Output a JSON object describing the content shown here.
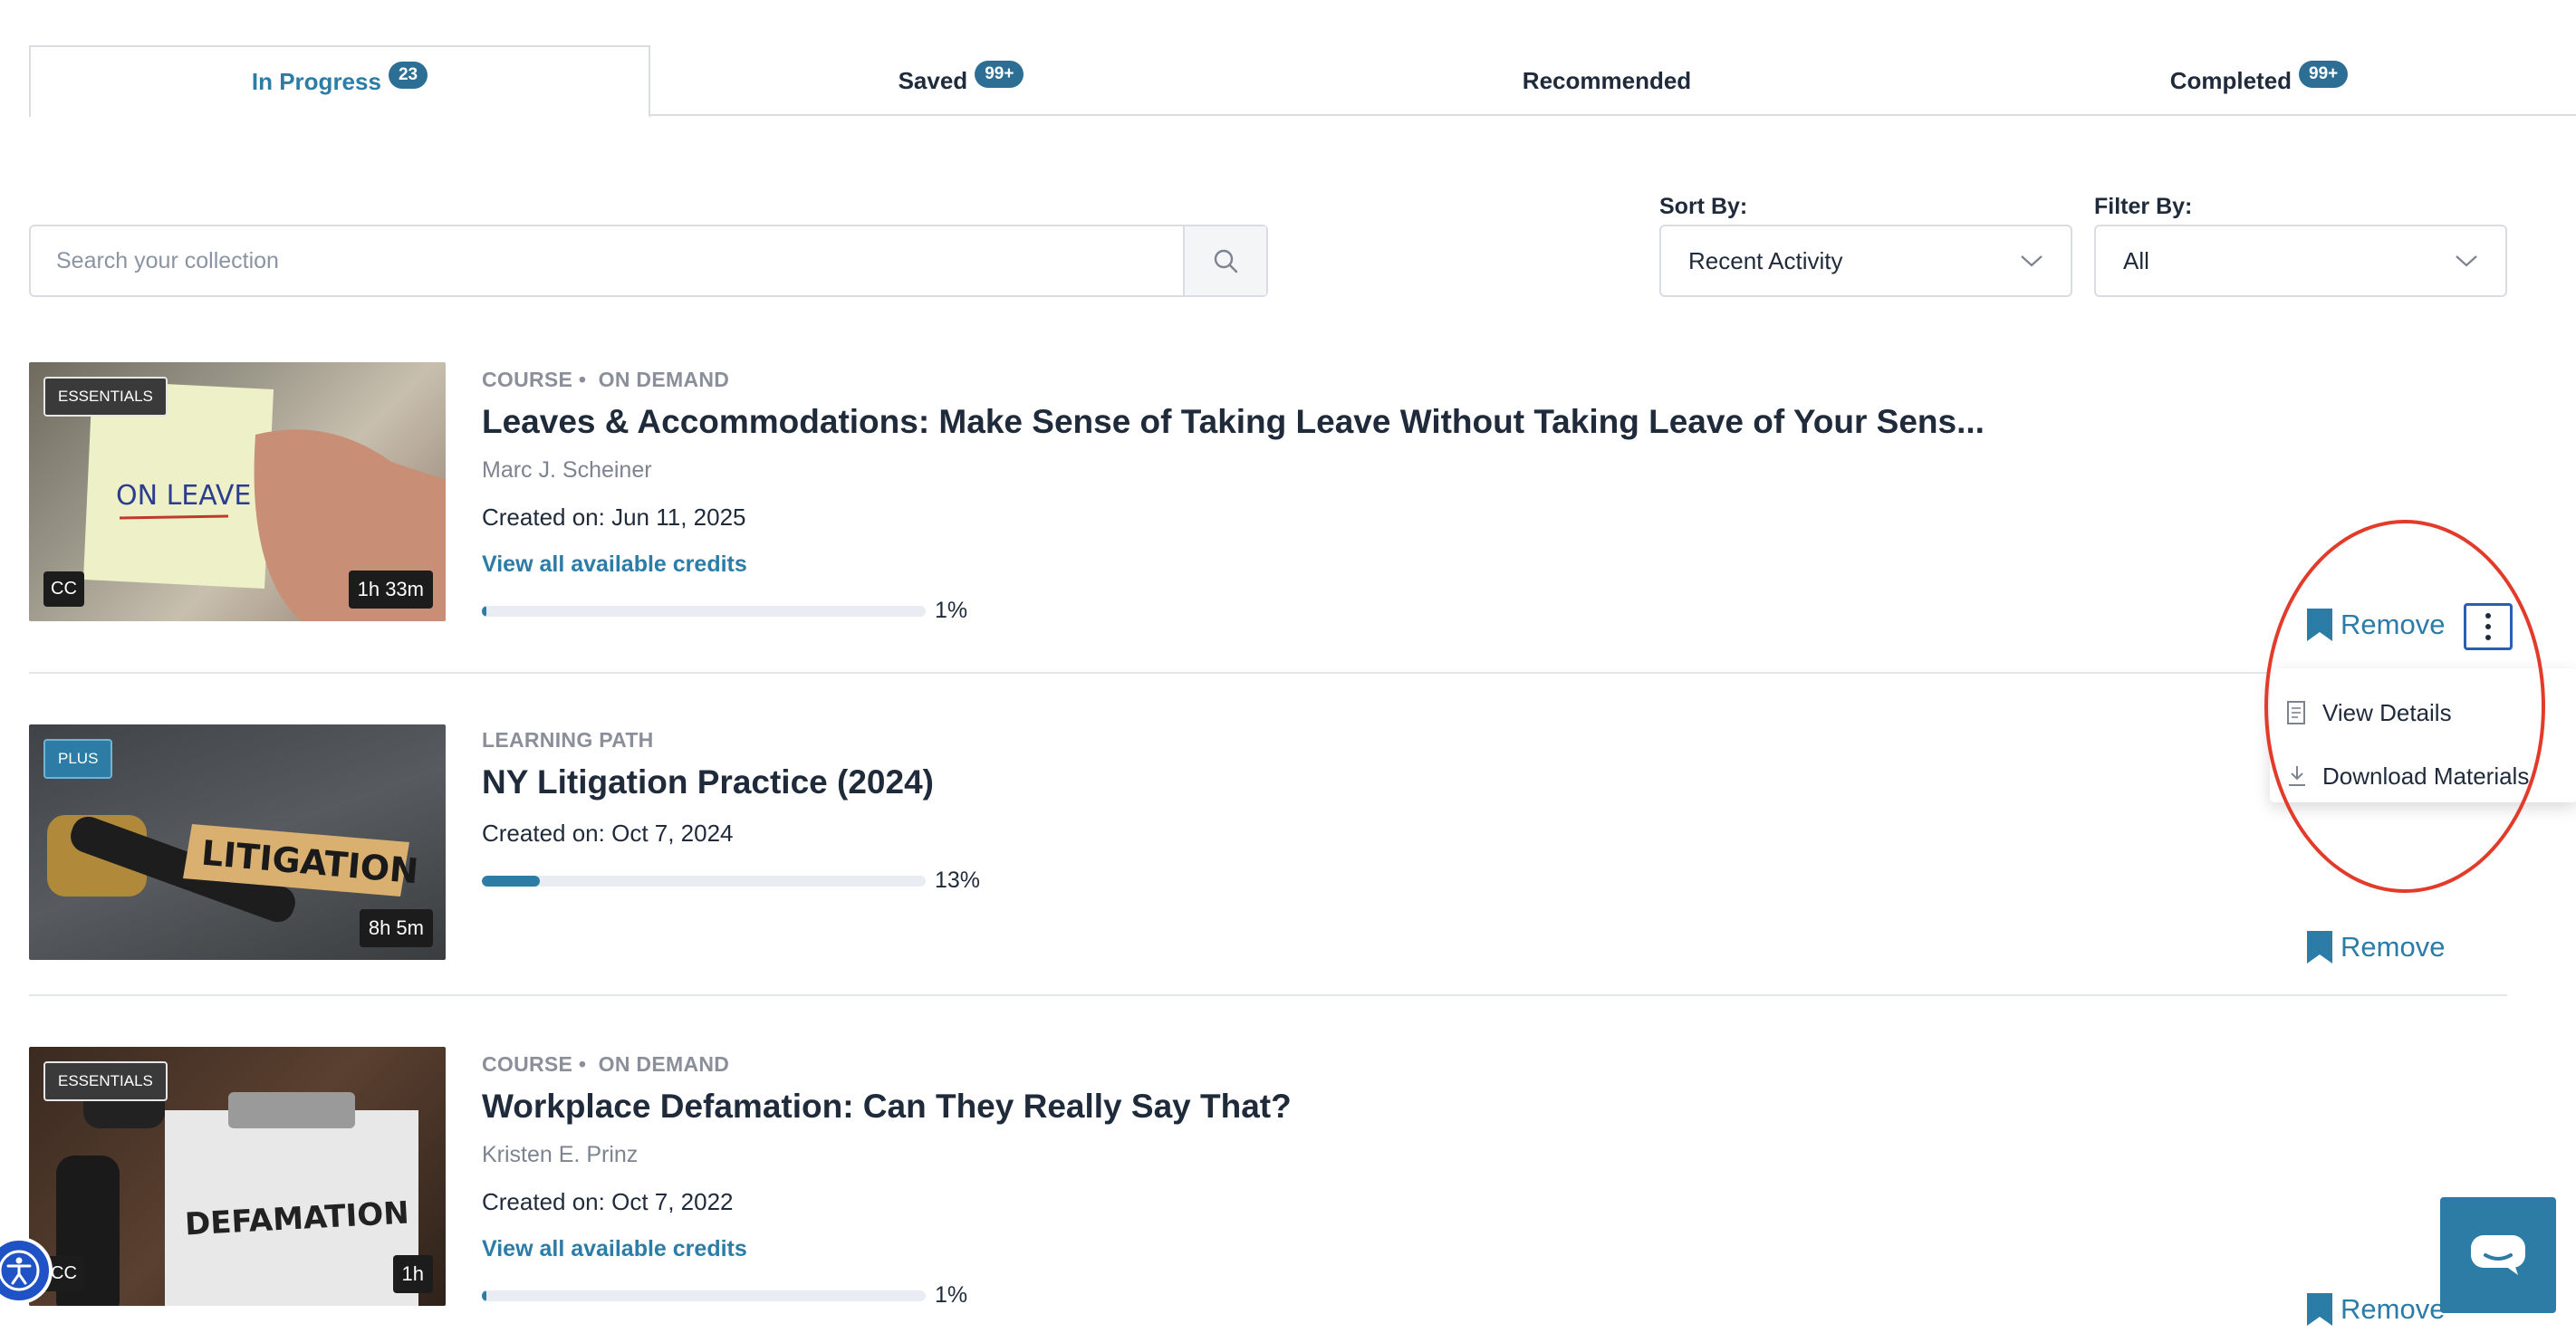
{
  "tabs": [
    {
      "label": "In Progress",
      "count": "23",
      "active": true
    },
    {
      "label": "Saved",
      "count": "99+",
      "active": false
    },
    {
      "label": "Recommended",
      "count": "",
      "active": false
    },
    {
      "label": "Completed",
      "count": "99+",
      "active": false
    }
  ],
  "search": {
    "placeholder": "Search your collection",
    "value": "",
    "icon": "search-icon"
  },
  "sort": {
    "label": "Sort By:",
    "value": "Recent Activity"
  },
  "filter": {
    "label": "Filter By:",
    "value": "All"
  },
  "items": [
    {
      "badge": "ESSENTIALS",
      "cc": "CC",
      "duration": "1h 33m",
      "type": "COURSE •",
      "format": "ON DEMAND",
      "title": "Leaves & Accommodations: Make Sense of Taking Leave Without Taking Leave of Your Sens...",
      "author": "Marc J. Scheiner",
      "created": "Created on: Jun 11, 2025",
      "credits_link": "View all available credits",
      "progress": 1,
      "progress_label": "1%",
      "remove_label": "Remove",
      "thumb_text": "ON LEAVE"
    },
    {
      "badge": "PLUS",
      "cc": "",
      "duration": "8h 5m",
      "type": "LEARNING PATH",
      "format": "",
      "title": "NY Litigation Practice (2024)",
      "author": "",
      "created": "Created on: Oct 7, 2024",
      "credits_link": "",
      "progress": 13,
      "progress_label": "13%",
      "remove_label": "Remove",
      "thumb_text": "LITIGATION"
    },
    {
      "badge": "ESSENTIALS",
      "cc": "CC",
      "duration": "1h",
      "type": "COURSE •",
      "format": "ON DEMAND",
      "title": "Workplace Defamation: Can They Really Say That?",
      "author": "Kristen E. Prinz",
      "created": "Created on: Oct 7, 2022",
      "credits_link": "View all available credits",
      "progress": 1,
      "progress_label": "1%",
      "remove_label": "Remove",
      "thumb_text": "DEFAMATION"
    }
  ],
  "context_menu": [
    {
      "label": "View Details",
      "icon": "document-icon"
    },
    {
      "label": "Download Materials",
      "icon": "download-icon"
    }
  ],
  "colors": {
    "accent": "#2b7ca6",
    "badge_bg": "#2d6f94",
    "annotation": "#e23b2a",
    "chat": "#2c7ca5"
  }
}
